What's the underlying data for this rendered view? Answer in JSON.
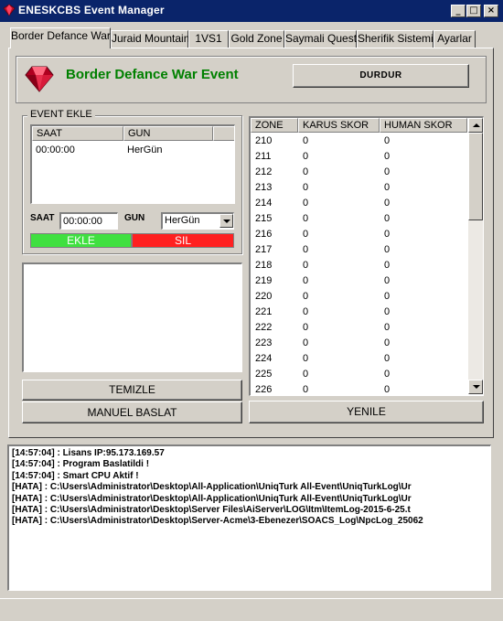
{
  "window": {
    "title": "ENESKCBS Event Manager",
    "minimize": "_",
    "maximize": "□",
    "close": "×"
  },
  "tabs": [
    {
      "label": "Border Defance War"
    },
    {
      "label": "Juraid Mountain"
    },
    {
      "label": "1VS1"
    },
    {
      "label": "Gold Zone"
    },
    {
      "label": "Saymali Quest"
    },
    {
      "label": "Sherifik Sistemi"
    },
    {
      "label": "Ayarlar"
    }
  ],
  "event_header": {
    "title": "Border Defance War Event",
    "stop_button": "DURDUR"
  },
  "event_ekle": {
    "group_label": "EVENT EKLE",
    "columns": [
      "SAAT",
      "GUN"
    ],
    "rows": [
      {
        "saat": "00:00:00",
        "gun": "HerGün"
      }
    ],
    "saat_label": "SAAT",
    "saat_value": "00:00:00",
    "gun_label": "GUN",
    "gun_value": "HerGün",
    "ekle_button": "EKLE",
    "sil_button": "SIL"
  },
  "buttons": {
    "temizle": "TEMIZLE",
    "manuel_baslat": "MANUEL BASLAT",
    "yenile": "YENILE"
  },
  "zone_table": {
    "columns": [
      "ZONE",
      "KARUS SKOR",
      "HUMAN SKOR"
    ],
    "rows": [
      {
        "zone": "210",
        "karus": "0",
        "human": "0"
      },
      {
        "zone": "211",
        "karus": "0",
        "human": "0"
      },
      {
        "zone": "212",
        "karus": "0",
        "human": "0"
      },
      {
        "zone": "213",
        "karus": "0",
        "human": "0"
      },
      {
        "zone": "214",
        "karus": "0",
        "human": "0"
      },
      {
        "zone": "215",
        "karus": "0",
        "human": "0"
      },
      {
        "zone": "216",
        "karus": "0",
        "human": "0"
      },
      {
        "zone": "217",
        "karus": "0",
        "human": "0"
      },
      {
        "zone": "218",
        "karus": "0",
        "human": "0"
      },
      {
        "zone": "219",
        "karus": "0",
        "human": "0"
      },
      {
        "zone": "220",
        "karus": "0",
        "human": "0"
      },
      {
        "zone": "221",
        "karus": "0",
        "human": "0"
      },
      {
        "zone": "222",
        "karus": "0",
        "human": "0"
      },
      {
        "zone": "223",
        "karus": "0",
        "human": "0"
      },
      {
        "zone": "224",
        "karus": "0",
        "human": "0"
      },
      {
        "zone": "225",
        "karus": "0",
        "human": "0"
      },
      {
        "zone": "226",
        "karus": "0",
        "human": "0"
      }
    ]
  },
  "log": [
    "[14:57:04] : Lisans IP:95.173.169.57",
    "[14:57:04] : Program Baslatildi !",
    "[14:57:04] : Smart CPU Aktif !",
    "[HATA] :  C:\\Users\\Administrator\\Desktop\\All-Application\\UniqTurk All-Event\\UniqTurkLog\\Ur",
    "[HATA] :  C:\\Users\\Administrator\\Desktop\\All-Application\\UniqTurk All-Event\\UniqTurkLog\\Ur",
    "[HATA] :  C:\\Users\\Administrator\\Desktop\\Server Files\\AiServer\\LOG\\Itm\\ItemLog-2015-6-25.t",
    "[HATA] :  C:\\Users\\Administrator\\Desktop\\Server-Acme\\3-Ebenezer\\SOACS_Log\\NpcLog_25062"
  ],
  "colors": {
    "title_bg": "#0a246a",
    "title_text": "#ffffff",
    "event_title": "#008000",
    "ekle_bg": "#40e040",
    "sil_bg": "#ff2020",
    "window_bg": "#d4d0c8"
  },
  "icons": {
    "app": "red-gem-icon",
    "event": "red-gem-icon"
  }
}
